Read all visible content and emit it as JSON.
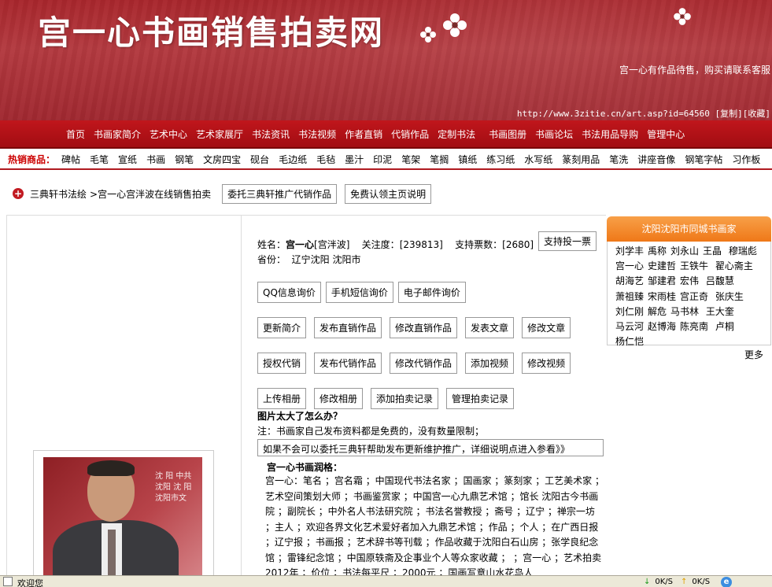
{
  "banner": {
    "site_title": "宫一心书画销售拍卖网",
    "note": "宫一心有作品待售，购买请联系客服",
    "url": "http://www.3zitie.cn/art.asp?id=64560 [复制][收藏]"
  },
  "main_nav": [
    "首页",
    "书画家简介",
    "艺术中心",
    "艺术家展厅",
    "书法资讯",
    "书法视频",
    "作者直销",
    "代销作品",
    "定制书法",
    "书画图册",
    "书画论坛",
    "书法用品导购",
    "管理中心"
  ],
  "hot": {
    "label": "热销商品：",
    "items": [
      "碑帖",
      "毛笔",
      "宣纸",
      "书画",
      "钢笔",
      "文房四宝",
      "砚台",
      "毛边纸",
      "毛毡",
      "墨汁",
      "印泥",
      "笔架",
      "笔搁",
      "镇纸",
      "练习纸",
      "水写纸",
      "篆刻用品",
      "笔洗",
      "讲座音像",
      "钢笔字帖",
      "习作板"
    ]
  },
  "breadcrumb": {
    "icon": "+",
    "root": "三典轩书法绘",
    "current": ">宫一心宫泮波在线销售拍卖",
    "btn_commission": "委托三典轩推广代销作品",
    "btn_free": "免费认领主页说明"
  },
  "profile": {
    "name_label": "姓名：",
    "name": "宫一心",
    "alias": "[宫泮波]",
    "attention_label": "关注度：",
    "attention": "[239813]",
    "votes_label": "支持票数：",
    "votes": "[2680]",
    "vote_button": "支持投一票",
    "province_label": "省份：",
    "province": "辽宁沈阳 沈阳市",
    "photo_sign": "沈 阳 中共沈阳 沈 阳 沈阳市文"
  },
  "contact_buttons": [
    "QQ信息询价",
    "手机短信询价",
    "电子邮件询价"
  ],
  "manage_row1": [
    "更新简介",
    "发布直销作品",
    "修改直销作品",
    "发表文章",
    "修改文章"
  ],
  "manage_row2": [
    "授权代销",
    "发布代销作品",
    "修改代销作品",
    "添加视频",
    "修改视频"
  ],
  "manage_row3": [
    "上传相册",
    "修改相册",
    "添加拍卖记录",
    "管理拍卖记录"
  ],
  "help": {
    "question": "图片太大了怎么办？",
    "note": "注：书画家自己发布资料都是免费的，没有数量限制；",
    "box": "如果不会可以委托三典轩帮助发布更新维护推广，详细说明点进入参看》》"
  },
  "bio": {
    "title": "宫一心书画润格：",
    "text": "宫一心：笔名 ；宫名霜 ；中国现代书法名家 ；国画家 ；篆刻家 ；工艺美术家 ；艺术空间策划大师 ；书画鉴赏家 ；中国宫一心九鼎艺术馆 ；馆长 沈阳古今书画院 ；副院长 ；中外名人书法研究院 ；书法名誉教授 ；斋号 ；辽宁 ；禅宗一坊 ；主人 ；欢迎各界文化艺术爱好者加入九鼎艺术馆 ；作品 ；个人 ；在广西日报 ；辽宁报 ；书画报 ；艺术辞书等刊载 ；作品收藏于沈阳白石山房 ；张学良纪念馆 ；雷锋纪念馆 ；中国原轶斋及企事业个人等众家收藏 ； ；宫一心 ；艺术拍卖2012年 ；价位 ；书法每平尺 ；2000元 ；国画写意山水花鸟人"
  },
  "city": {
    "header": "沈阳沈阳市同城书画家",
    "artists": [
      "刘学丰",
      "禹称",
      "刘永山",
      "王晶",
      "穆瑞彪",
      "宫一心",
      "史建哲",
      "王铁牛",
      "翟心斋主",
      "胡海艺",
      "邹建君",
      "宏伟",
      "吕馥慧",
      "萧祖臻",
      "宋雨桂",
      "宫正奇",
      "张庆生",
      "刘仁刚",
      "解危",
      "马书林",
      "王大奎",
      "马云河",
      "赵博海",
      "陈亮南",
      "卢桐",
      "杨仁恺"
    ],
    "more": "更多"
  },
  "status": {
    "text": "欢迎您",
    "down": "0K/S",
    "up": "0K/S",
    "ie_glyph": "e"
  },
  "colors": {
    "banner": "#a8262c",
    "nav": "#b01218",
    "hot_label": "#cc0000",
    "city_header": "#ef7818"
  }
}
